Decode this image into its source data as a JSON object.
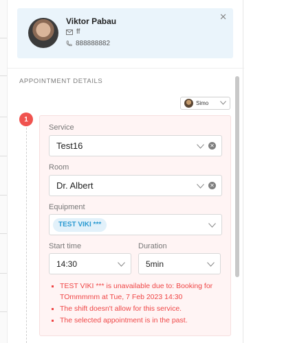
{
  "client": {
    "name": "Viktor Pabau",
    "email": "ff",
    "phone": "888888882"
  },
  "section": {
    "title": "APPOINTMENT DETAILS"
  },
  "staff": {
    "name": "Simo"
  },
  "step": {
    "number": "1"
  },
  "form": {
    "service": {
      "label": "Service",
      "value": "Test16"
    },
    "room": {
      "label": "Room",
      "value": "Dr. Albert"
    },
    "equipment": {
      "label": "Equipment",
      "tag": "TEST VIKI ***"
    },
    "start_time": {
      "label": "Start time",
      "value": "14:30"
    },
    "duration": {
      "label": "Duration",
      "value": "5min"
    }
  },
  "errors": [
    "TEST VIKI *** is unavailable due to: Booking for TOmmmmm at Tue, 7 Feb 2023 14:30",
    "The shift doesn't allow for this service.",
    "The selected appointment is in the past."
  ],
  "colors": {
    "accent": "#2b9ad1",
    "error": "#ef4545",
    "badge": "#f0534f",
    "card_bg": "#eaf4fb",
    "form_bg": "#fff4f4"
  }
}
